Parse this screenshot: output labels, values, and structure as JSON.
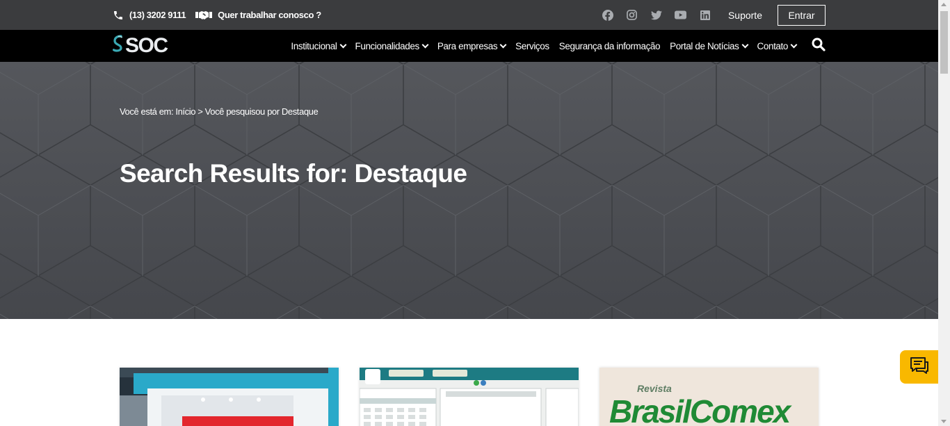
{
  "topbar": {
    "phone": "(13) 3202 9111",
    "careers": "Quer trabalhar conosco ?",
    "social_icons": [
      "facebook-icon",
      "instagram-icon",
      "twitter-icon",
      "youtube-icon",
      "linkedin-icon"
    ],
    "support": "Suporte",
    "login": "Entrar"
  },
  "nav": {
    "logo": "SOC",
    "items": [
      {
        "label": "Institucional",
        "dropdown": true
      },
      {
        "label": "Funcionalidades",
        "dropdown": true
      },
      {
        "label": "Para empresas",
        "dropdown": true
      },
      {
        "label": "Serviços",
        "dropdown": false
      },
      {
        "label": "Segurança da informação",
        "dropdown": false
      },
      {
        "label": "Portal de Notícias",
        "dropdown": true
      },
      {
        "label": "Contato",
        "dropdown": true
      }
    ],
    "search_icon": "search-icon"
  },
  "hero": {
    "breadcrumb": "Você está em: Início > Você pesquisou por Destaque",
    "title": "Search Results for: Destaque"
  },
  "cards": {
    "card3_revista": "Revista",
    "card3_title": "BrasilComex"
  },
  "colors": {
    "topbar_bg": "#3b3c3e",
    "nav_bg": "#000000",
    "hero_bg": "#4a4c51",
    "chat_accent": "#f9b800",
    "logo_teal": "#3aa9b4"
  }
}
